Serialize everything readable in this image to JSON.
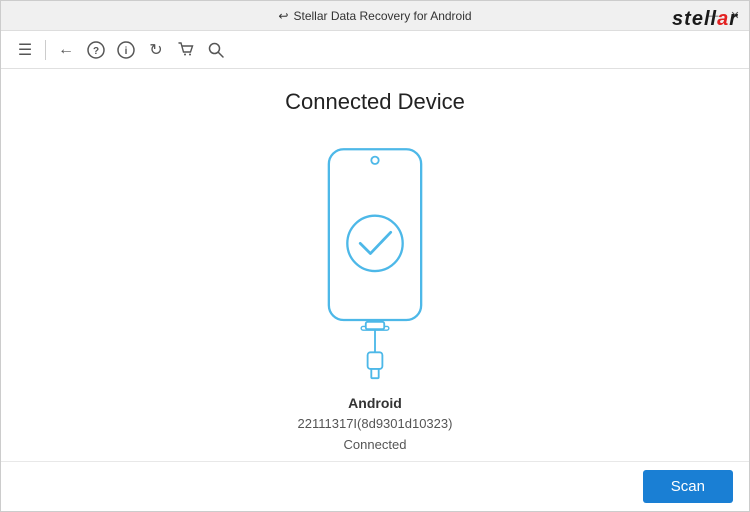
{
  "titleBar": {
    "backIcon": "↩",
    "title": "Stellar Data Recovery for Android",
    "minimizeBtn": "—",
    "closeBtn": "✕"
  },
  "toolbar": {
    "menuIcon": "☰",
    "backIcon": "←",
    "helpIcon": "①",
    "infoIcon": "○",
    "refreshIcon": "↻",
    "cartIcon": "⊓",
    "searchIcon": "🔍"
  },
  "brand": {
    "text": "stellar",
    "dotColor": "#e32222"
  },
  "main": {
    "heading": "Connected Device",
    "deviceName": "Android",
    "deviceId": "22111317I(8d9301d10323)",
    "deviceStatus": "Connected"
  },
  "footer": {
    "scanLabel": "Scan"
  }
}
